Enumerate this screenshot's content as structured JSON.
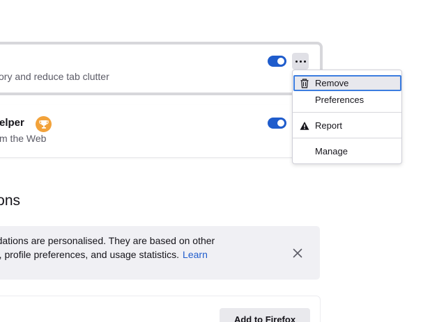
{
  "extensions": [
    {
      "description": "ory and reduce tab clutter",
      "enabled": true
    },
    {
      "name": "elper",
      "description": "m the Web",
      "enabled": true
    }
  ],
  "more_options_menu": {
    "items": [
      {
        "label": "Remove",
        "icon": "trash-icon",
        "highlighted": true
      },
      {
        "label": "Preferences"
      },
      {
        "label": "Report",
        "icon": "warning-icon"
      },
      {
        "label": "Manage"
      }
    ]
  },
  "recommended": {
    "title": "sions",
    "notice_line1": "endations are personalised. They are based on other",
    "notice_line2": "led, profile preferences, and usage statistics.",
    "learn_link": "Learn",
    "add_button": "Add to Firefox"
  },
  "colors": {
    "accent": "#1f5ccc",
    "badge": "#f2a23a",
    "focus_ring": "#3b7de0"
  }
}
